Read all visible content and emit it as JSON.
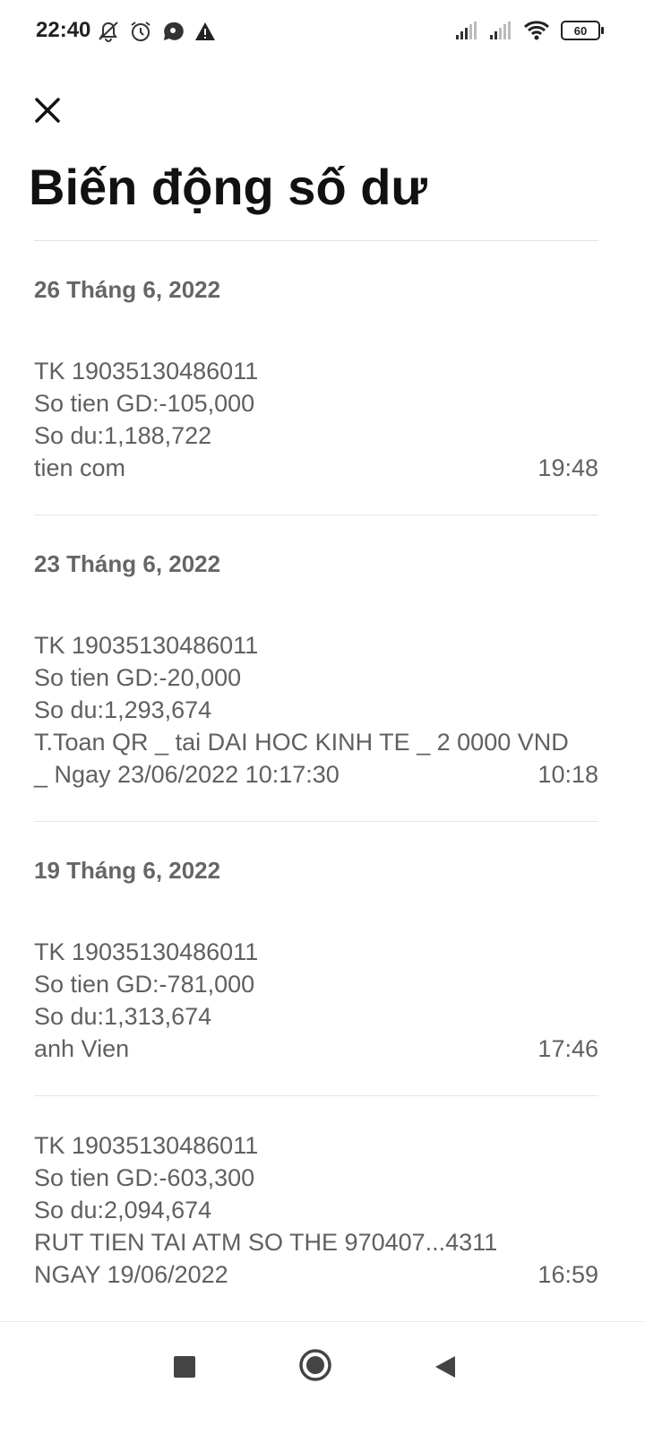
{
  "status_bar": {
    "time": "22:40",
    "battery": "60",
    "icons": [
      "bell-off-icon",
      "alarm-icon",
      "messenger-icon",
      "warning-icon",
      "signal-icon",
      "signal-icon",
      "wifi-icon",
      "battery-icon"
    ]
  },
  "header": {
    "close_icon": "close-icon",
    "title": "Biến động số dư"
  },
  "groups": [
    {
      "date": "26 Tháng 6, 2022",
      "transactions": [
        {
          "account": "TK 19035130486011",
          "amount": "So tien GD:-105,000",
          "balance": "So du:1,188,722",
          "description": [
            "tien com"
          ],
          "time": "19:48"
        }
      ]
    },
    {
      "date": "23 Tháng 6, 2022",
      "transactions": [
        {
          "account": "TK 19035130486011",
          "amount": "So tien GD:-20,000",
          "balance": "So du:1,293,674",
          "description": [
            "T.Toan QR _ tai DAI HOC KINH TE _ 2 0000 VND",
            "_ Ngay 23/06/2022 10:17:30"
          ],
          "time": "10:18"
        }
      ]
    },
    {
      "date": "19 Tháng 6, 2022",
      "transactions": [
        {
          "account": "TK 19035130486011",
          "amount": "So tien GD:-781,000",
          "balance": "So du:1,313,674",
          "description": [
            "anh Vien"
          ],
          "time": "17:46"
        },
        {
          "account": "TK 19035130486011",
          "amount": "So tien GD:-603,300",
          "balance": "So du:2,094,674",
          "description": [
            "RUT TIEN TAI ATM SO THE 970407...4311",
            "NGAY 19/06/2022"
          ],
          "time": "16:59"
        }
      ]
    }
  ],
  "nav_bar": {
    "icons": [
      "recents-square-icon",
      "home-circle-icon",
      "back-triangle-icon"
    ]
  }
}
